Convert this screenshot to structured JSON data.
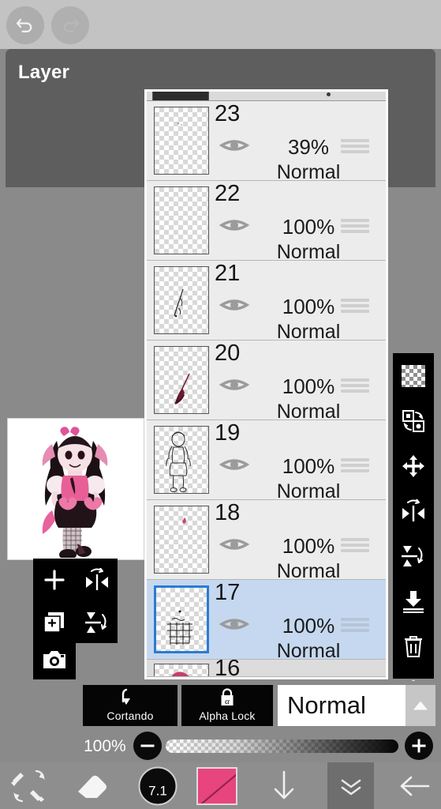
{
  "app": {
    "dialog_title": "Layer"
  },
  "topbar": {
    "undo_icon": "undo-arrow-icon",
    "redo_icon": "redo-arrow-icon"
  },
  "layers": {
    "partial_top": {
      "label": ""
    },
    "items": [
      {
        "number": "23",
        "opacity": "39%",
        "blend": "Normal",
        "selected": false,
        "visible": true,
        "thumb": "empty"
      },
      {
        "number": "22",
        "opacity": "100%",
        "blend": "Normal",
        "selected": false,
        "visible": true,
        "thumb": "empty"
      },
      {
        "number": "21",
        "opacity": "100%",
        "blend": "Normal",
        "selected": false,
        "visible": true,
        "thumb": "thin-sketch-stroke"
      },
      {
        "number": "20",
        "opacity": "100%",
        "blend": "Normal",
        "selected": false,
        "visible": true,
        "thumb": "dark-red-brush"
      },
      {
        "number": "19",
        "opacity": "100%",
        "blend": "Normal",
        "selected": false,
        "visible": true,
        "thumb": "character-lineart"
      },
      {
        "number": "18",
        "opacity": "100%",
        "blend": "Normal",
        "selected": false,
        "visible": true,
        "thumb": "small-pink-mark"
      },
      {
        "number": "17",
        "opacity": "100%",
        "blend": "Normal",
        "selected": true,
        "visible": true,
        "thumb": "fishnet-pattern"
      }
    ],
    "partial_bottom": {
      "number": "16",
      "thumb": "pink-blob"
    }
  },
  "right_tools": [
    {
      "name": "transparency-checker",
      "icon": "checkerboard-icon"
    },
    {
      "name": "swap-layer",
      "icon": "swap-layers-icon"
    },
    {
      "name": "move-layer",
      "icon": "move-arrows-icon"
    },
    {
      "name": "flip-horizontal",
      "icon": "flip-horizontal-icon"
    },
    {
      "name": "flip-vertical",
      "icon": "flip-vertical-icon"
    },
    {
      "name": "merge-down",
      "icon": "merge-down-icon"
    },
    {
      "name": "delete-layer",
      "icon": "trash-icon"
    },
    {
      "name": "more-options",
      "icon": "more-vertical-icon"
    }
  ],
  "left_tools": [
    {
      "name": "add-layer",
      "icon": "plus-icon"
    },
    {
      "name": "flip-horizontal",
      "icon": "flip-horizontal-icon"
    },
    {
      "name": "duplicate-layer",
      "icon": "duplicate-layer-icon"
    },
    {
      "name": "flip-vertical",
      "icon": "flip-vertical-icon"
    },
    {
      "name": "import-photo",
      "icon": "camera-icon"
    }
  ],
  "options": {
    "clipping_label": "Cortando",
    "clipping_icon": "clipping-arrow-icon",
    "alpha_lock_label": "Alpha Lock",
    "alpha_lock_icon": "alpha-lock-icon",
    "blend_mode": "Normal",
    "blend_arrow_icon": "triangle-up-icon"
  },
  "opacity_slider": {
    "value_label": "100%",
    "minus_icon": "minus-icon",
    "plus_icon": "plus-icon",
    "percent": 100
  },
  "nav_bar": {
    "swap_icon": "brush-eraser-swap-icon",
    "eraser_icon": "eraser-icon",
    "brush_size": "7.1",
    "color_swatch": "#e8447e",
    "down_icon": "arrow-down-icon",
    "collapse_icon": "double-chevron-down-icon",
    "back_icon": "arrow-left-icon"
  },
  "canvas": {
    "preview_name": "artwork-preview"
  },
  "colors": {
    "panel_bg": "#e9e9e9",
    "selected_row": "#c5d8ef",
    "selection_border": "#2b7cd3",
    "dialog_header": "#5e5e5e",
    "body_gray": "#8a8a8a",
    "topbar_gray": "#c3c3c3",
    "accent_pink": "#e8447e"
  }
}
